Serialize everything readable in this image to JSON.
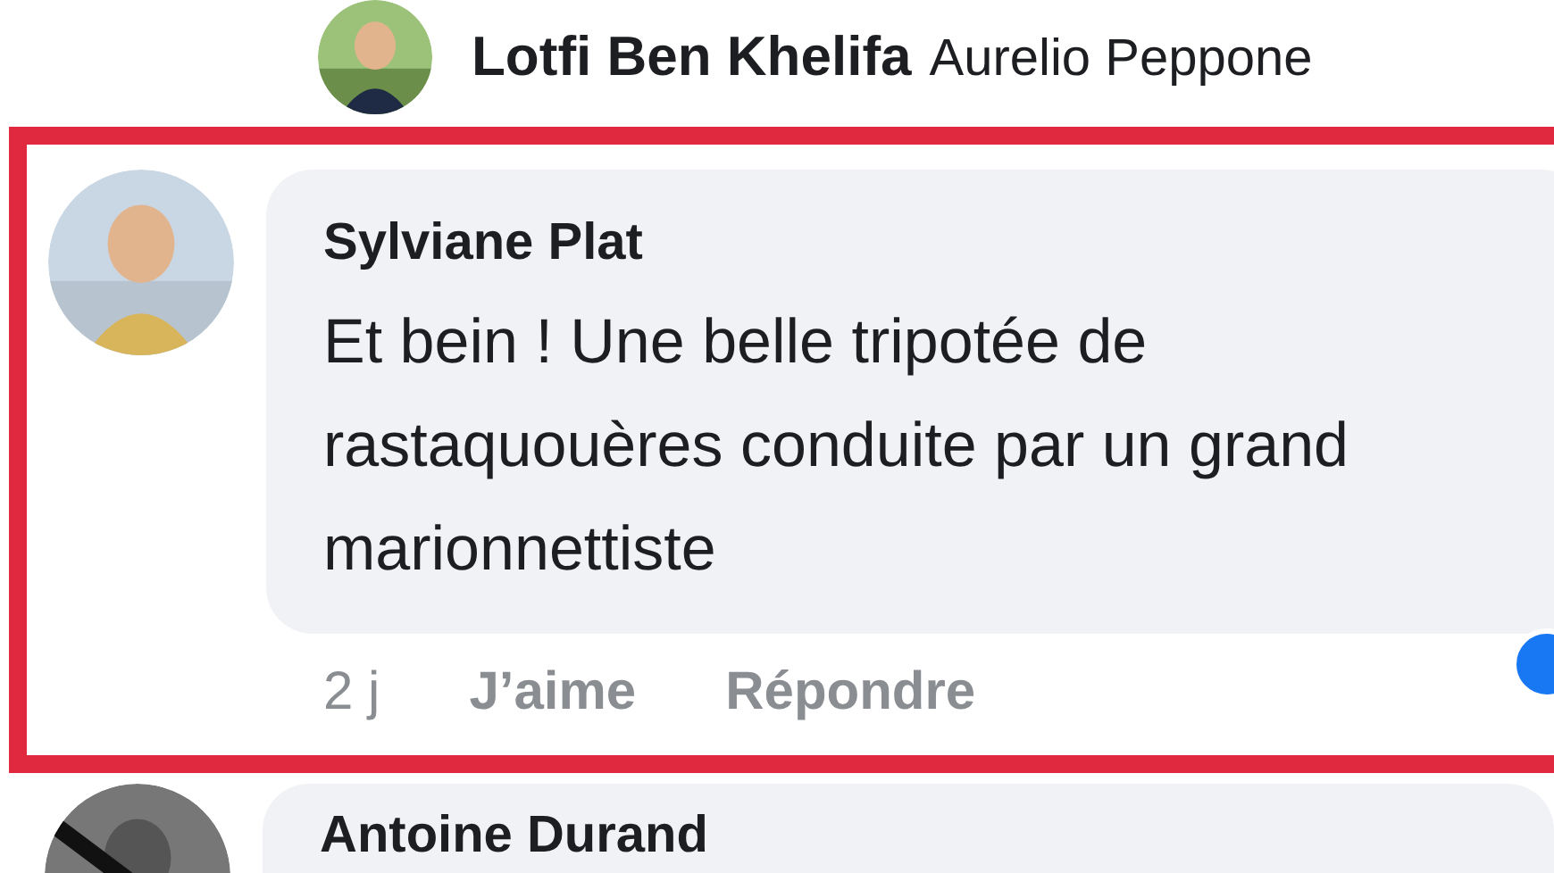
{
  "reply_preview": {
    "author": "Lotfi Ben Khelifa",
    "text": "Aurelio Peppone"
  },
  "comment": {
    "highlighted": true,
    "author": "Sylviane Plat",
    "text": "Et bein ! Une belle tripotée de rastaquouères conduite par un grand marionnettiste",
    "time": "2 j",
    "actions": [
      "J’aime",
      "Répondre"
    ]
  },
  "next_comment": {
    "author": "Antoine Durand"
  }
}
